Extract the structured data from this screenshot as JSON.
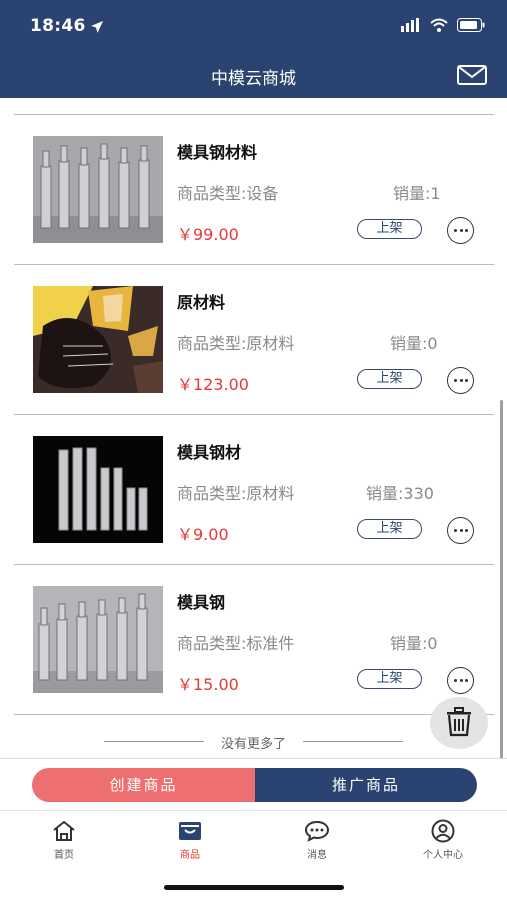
{
  "status": {
    "time": "18:46"
  },
  "header": {
    "title": "中模云商城",
    "mail_icon": "mail-icon"
  },
  "products": [
    {
      "name": "模具钢材料",
      "type": "商品类型:设备",
      "sales": "销量:1",
      "price": "￥99.00",
      "shelf_label": "上架"
    },
    {
      "name": "原材料",
      "type": "商品类型:原材料",
      "sales": "销量:0",
      "price": "￥123.00",
      "shelf_label": "上架"
    },
    {
      "name": "模具钢材",
      "type": "商品类型:原材料",
      "sales": "销量:330",
      "price": "￥9.00",
      "shelf_label": "上架"
    },
    {
      "name": "模具钢",
      "type": "商品类型:标准件",
      "sales": "销量:0",
      "price": "￥15.00",
      "shelf_label": "上架"
    }
  ],
  "list_end_text": "没有更多了",
  "actions": {
    "create": "创建商品",
    "promote": "推广商品"
  },
  "tabs": [
    {
      "label": "首页",
      "icon": "home-icon"
    },
    {
      "label": "商品",
      "icon": "product-icon",
      "active": true
    },
    {
      "label": "消息",
      "icon": "message-icon"
    },
    {
      "label": "个人中心",
      "icon": "profile-icon"
    }
  ],
  "colors": {
    "header": "#2b4370",
    "price": "#e53935",
    "create_button": "#ee6f70",
    "promote_button": "#2b4370"
  }
}
